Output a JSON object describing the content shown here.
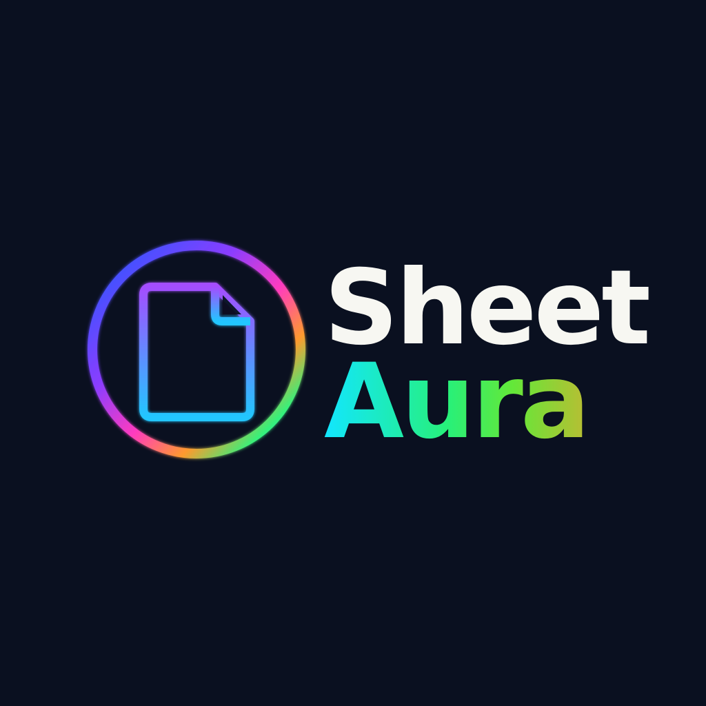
{
  "brand": {
    "line1": "Sheet",
    "line2": "Aura"
  },
  "icons": {
    "ring": "gradient-ring-icon",
    "document": "document-icon"
  },
  "colors": {
    "background": "#0a1020",
    "text_primary": "#f7f7f2",
    "ring_blue": "#1f5cff",
    "ring_magenta": "#ff3bbf",
    "ring_orange": "#ff9a2e",
    "ring_green": "#36f07a",
    "ring_cyan": "#12e6ff",
    "doc_violet": "#a44dff",
    "doc_cyan": "#22c6ff"
  }
}
